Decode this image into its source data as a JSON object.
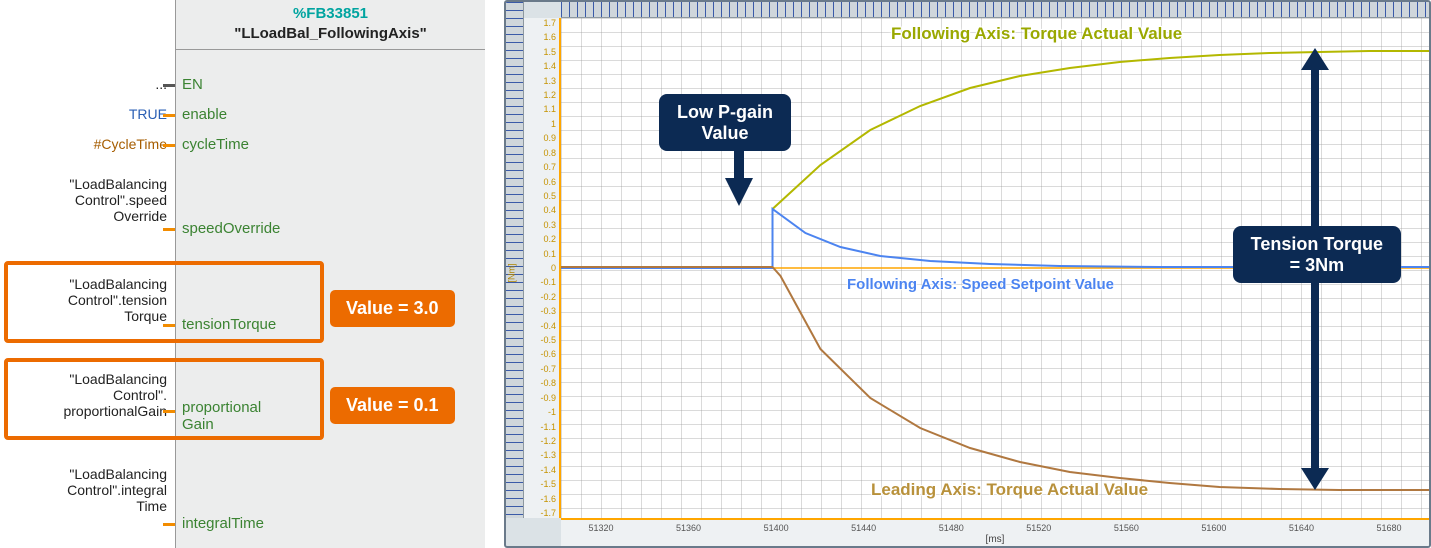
{
  "block": {
    "fb_id": "%FB33851",
    "fb_name": "\"LLoadBal_FollowingAxis\"",
    "pins": {
      "en": "EN",
      "enable": "enable",
      "cycleTime": "cycleTime",
      "speedOverride": "speedOverride",
      "tensionTorque": "tensionTorque",
      "proportionalGain": "proportional\nGain",
      "integralTime": "integralTime"
    },
    "tags": {
      "ellipsis": "...",
      "true": "TRUE",
      "cycle": "#CycleTime",
      "speed": "\"LoadBalancing\nControl\".speed\nOverride",
      "tension": "\"LoadBalancing\nControl\".tension\nTorque",
      "pgain": "\"LoadBalancing\nControl\".\nproportionalGain",
      "itime": "\"LoadBalancing\nControl\".integral\nTime"
    },
    "highlights": {
      "tension_value": "Value = 3.0",
      "pgain_value": "Value = 0.1"
    }
  },
  "chart": {
    "y_ticks": [
      "1.7",
      "1.6",
      "1.5",
      "1.4",
      "1.3",
      "1.2",
      "1.1",
      "1",
      "0.9",
      "0.8",
      "0.7",
      "0.6",
      "0.5",
      "0.4",
      "0.3",
      "0.2",
      "0.1",
      "0",
      "-0.1",
      "-0.2",
      "-0.3",
      "-0.4",
      "-0.5",
      "-0.6",
      "-0.7",
      "-0.8",
      "-0.9",
      "-1",
      "-1.1",
      "-1.2",
      "-1.3",
      "-1.4",
      "-1.5",
      "-1.6",
      "-1.7"
    ],
    "y_unit": "[Nm]",
    "x_ticks": [
      "51320",
      "51360",
      "51400",
      "51440",
      "51480",
      "51520",
      "51560",
      "51600",
      "51640",
      "51680"
    ],
    "x_unit": "[ms]",
    "annotations": {
      "pgain": "Low P-gain\nValue",
      "tension": "Tension Torque\n= 3Nm"
    },
    "series_labels": {
      "following_torque": "Following Axis: Torque Actual Value",
      "speed_setpoint": "Following Axis: Speed Setpoint Value",
      "leading_torque": "Leading Axis: Torque Actual Value"
    }
  },
  "chart_data": {
    "type": "line",
    "title": "",
    "xlabel": "[ms]",
    "ylabel": "[Nm]",
    "xlim": [
      51300,
      51710
    ],
    "ylim": [
      -1.7,
      1.7
    ],
    "x": [
      51300,
      51320,
      51340,
      51360,
      51380,
      51400,
      51401,
      51420,
      51440,
      51460,
      51480,
      51500,
      51520,
      51540,
      51560,
      51580,
      51600,
      51620,
      51640,
      51660,
      51680,
      51700,
      51710
    ],
    "series": [
      {
        "name": "Following Axis: Torque Actual Value",
        "color": "#b3b800",
        "values": [
          0.01,
          0.01,
          0.01,
          0.01,
          0.01,
          0.01,
          0.4,
          0.7,
          0.94,
          1.1,
          1.22,
          1.3,
          1.36,
          1.4,
          1.43,
          1.45,
          1.46,
          1.47,
          1.48,
          1.48,
          1.48,
          1.48,
          1.48
        ]
      },
      {
        "name": "Following Axis: Speed Setpoint Value",
        "color": "#4c84f0",
        "values": [
          0.0,
          0.0,
          0.0,
          0.0,
          0.0,
          0.0,
          0.4,
          0.24,
          0.14,
          0.09,
          0.06,
          0.04,
          0.025,
          0.018,
          0.012,
          0.01,
          0.008,
          0.006,
          0.005,
          0.004,
          0.004,
          0.004,
          0.004
        ]
      },
      {
        "name": "Leading Axis: Torque Actual Value",
        "color": "#b07840",
        "values": [
          0.01,
          0.01,
          0.01,
          0.01,
          0.01,
          0.01,
          -0.05,
          -0.55,
          -0.88,
          -1.08,
          -1.22,
          -1.32,
          -1.38,
          -1.42,
          -1.45,
          -1.47,
          -1.49,
          -1.5,
          -1.51,
          -1.51,
          -1.51,
          -1.51,
          -1.51
        ]
      }
    ],
    "annotations": [
      {
        "text": "Low P-gain Value",
        "points_to_x": 51401,
        "points_to_y": 0.4
      },
      {
        "text": "Tension Torque = 3Nm",
        "span_y": [
          -1.51,
          1.48
        ],
        "at_x": 51640
      }
    ]
  }
}
